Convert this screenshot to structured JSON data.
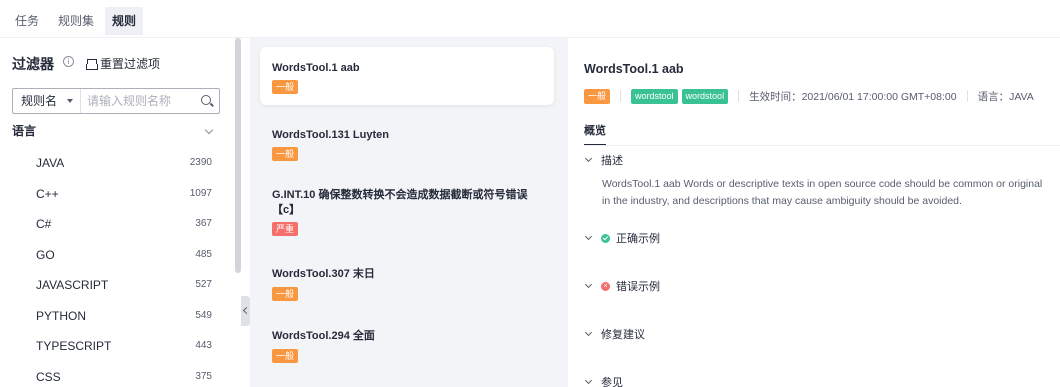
{
  "tabs": [
    "任务",
    "规则集",
    "规则"
  ],
  "filter": {
    "title": "过滤器",
    "reset_label": "重置过滤项",
    "search_field": "规则名",
    "search_placeholder": "请输入规则名称",
    "group_label": "语言",
    "languages": [
      {
        "name": "JAVA",
        "count": "2390"
      },
      {
        "name": "C++",
        "count": "1097"
      },
      {
        "name": "C#",
        "count": "367"
      },
      {
        "name": "GO",
        "count": "485"
      },
      {
        "name": "JAVASCRIPT",
        "count": "527"
      },
      {
        "name": "PYTHON",
        "count": "549"
      },
      {
        "name": "TYPESCRIPT",
        "count": "443"
      },
      {
        "name": "CSS",
        "count": "375"
      }
    ]
  },
  "rules": [
    {
      "title": "WordsTool.1 aab",
      "level": "一般"
    },
    {
      "title": "WordsTool.131 Luyten",
      "level": "一般"
    },
    {
      "title": "G.INT.10 确保整数转换不会造成数据截断或符号错误【c】",
      "level": "严重"
    },
    {
      "title": "WordsTool.307 末日",
      "level": "一般"
    },
    {
      "title": "WordsTool.294 全面",
      "level": "一般"
    }
  ],
  "detail": {
    "title": "WordsTool.1 aab",
    "level": "一般",
    "tags": [
      "wordstool",
      "wordstool"
    ],
    "effective_time": "生效时间：2021/06/01 17:00:00 GMT+08:00",
    "language": "语言：JAVA",
    "tab_overview": "概览",
    "sections": {
      "description": "描述",
      "correct_example": "正确示例",
      "wrong_example": "错误示例",
      "fix_suggestion": "修复建议",
      "references": "参见"
    },
    "description_text": "WordsTool.1 aab Words or descriptive texts in open source code should be common or original in the industry, and descriptions that may cause ambiguity should be avoided."
  },
  "colors": {
    "general": "#fa9841",
    "severe": "#f66f6a",
    "tag": "#3ac295"
  }
}
